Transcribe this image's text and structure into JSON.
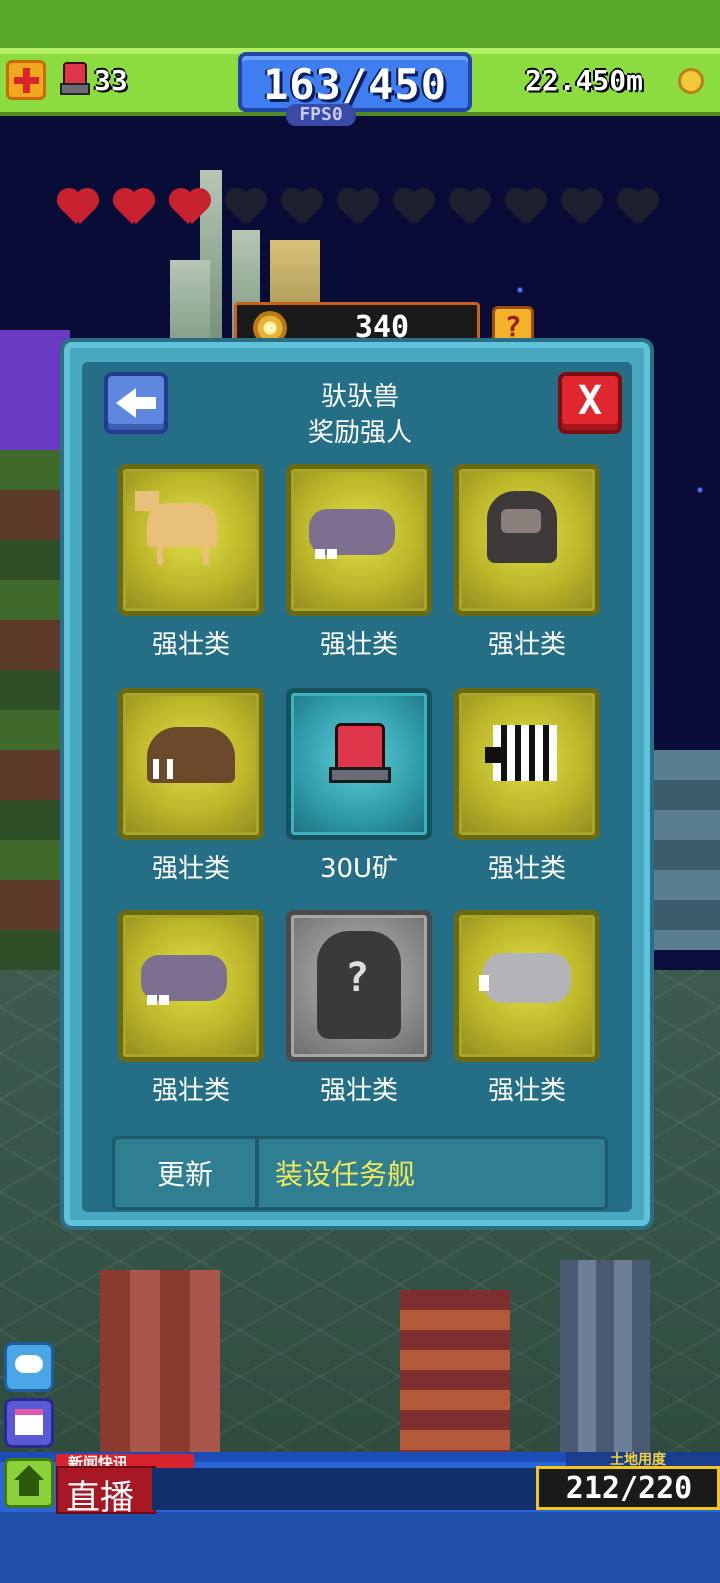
{
  "hud": {
    "beacon_count": "33",
    "population": "163/450",
    "fps": "FPS0",
    "money": "22.450m"
  },
  "hearts": {
    "full": 3,
    "total": 11
  },
  "resource": {
    "value": "340",
    "help_label": "?"
  },
  "dialog": {
    "title": "驮驮兽",
    "subtitle": "奖励强人",
    "close_label": "X",
    "cards": [
      {
        "label": "强壮类",
        "icon": "camel-icon",
        "style": "gold"
      },
      {
        "label": "强壮类",
        "icon": "hippo-icon",
        "style": "gold"
      },
      {
        "label": "强壮类",
        "icon": "gorilla-icon",
        "style": "gold"
      },
      {
        "label": "强壮类",
        "icon": "walrus-icon",
        "style": "gold"
      },
      {
        "label": "30U矿",
        "icon": "beacon-icon",
        "style": "teal"
      },
      {
        "label": "强壮类",
        "icon": "zebra-icon",
        "style": "gold"
      },
      {
        "label": "强壮类",
        "icon": "hippo-icon",
        "style": "gold"
      },
      {
        "label": "强壮类",
        "icon": "mystery-icon",
        "style": "grey"
      },
      {
        "label": "强壮类",
        "icon": "elephant-icon",
        "style": "gold"
      }
    ],
    "update_label": "更新",
    "mission_label": "装设任务舰"
  },
  "bottom": {
    "news_tag": "新闻快讯",
    "live_label": "直播",
    "land_tag": "土地用度",
    "land_value": "212/220"
  },
  "colors": {
    "accent_green": "#8bdc3f",
    "panel_teal": "#48a8c0",
    "mission_yellow": "#f2e85a"
  }
}
